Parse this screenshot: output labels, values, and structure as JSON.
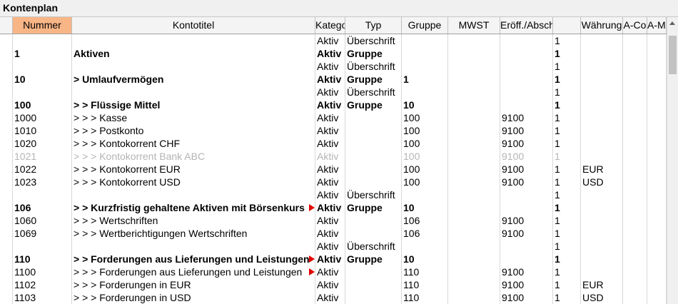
{
  "window": {
    "title": "Kontenplan"
  },
  "columns": [
    {
      "key": "nummer",
      "label": "Nummer"
    },
    {
      "key": "titel",
      "label": "Kontotitel"
    },
    {
      "key": "kategorie",
      "label": "Katego"
    },
    {
      "key": "typ",
      "label": "Typ"
    },
    {
      "key": "gruppe",
      "label": "Gruppe"
    },
    {
      "key": "mwst",
      "label": "MWST"
    },
    {
      "key": "eroeff",
      "label": "Eröff./Abschl."
    },
    {
      "key": "one",
      "label": ""
    },
    {
      "key": "waehrung",
      "label": "Währung"
    },
    {
      "key": "acode",
      "label": "A-Co"
    },
    {
      "key": "amode",
      "label": "A-Mo"
    }
  ],
  "active_column": "nummer",
  "rows": [
    {
      "style": "normal",
      "nummer": "",
      "titel": "",
      "kategorie": "Aktiv",
      "typ": "Überschrift",
      "gruppe": "",
      "mwst": "",
      "eroeff": "",
      "one": "1",
      "waehrung": "",
      "marker": false
    },
    {
      "style": "bold",
      "nummer": "1",
      "titel": "Aktiven",
      "kategorie": "Aktiv",
      "typ": "Gruppe",
      "gruppe": "",
      "mwst": "",
      "eroeff": "",
      "one": "1",
      "waehrung": "",
      "marker": false
    },
    {
      "style": "normal",
      "nummer": "",
      "titel": "",
      "kategorie": "Aktiv",
      "typ": "Überschrift",
      "gruppe": "",
      "mwst": "",
      "eroeff": "",
      "one": "1",
      "waehrung": "",
      "marker": false
    },
    {
      "style": "bold",
      "nummer": "10",
      "titel": " > Umlaufvermögen",
      "kategorie": "Aktiv",
      "typ": "Gruppe",
      "gruppe": "1",
      "mwst": "",
      "eroeff": "",
      "one": "1",
      "waehrung": "",
      "marker": false
    },
    {
      "style": "normal",
      "nummer": "",
      "titel": "",
      "kategorie": "Aktiv",
      "typ": "Überschrift",
      "gruppe": "",
      "mwst": "",
      "eroeff": "",
      "one": "1",
      "waehrung": "",
      "marker": false
    },
    {
      "style": "bold",
      "nummer": "100",
      "titel": " >  > Flüssige Mittel",
      "kategorie": "Aktiv",
      "typ": "Gruppe",
      "gruppe": "10",
      "mwst": "",
      "eroeff": "",
      "one": "1",
      "waehrung": "",
      "marker": false
    },
    {
      "style": "normal",
      "nummer": "1000",
      "titel": " >  >  > Kasse",
      "kategorie": "Aktiv",
      "typ": "",
      "gruppe": "100",
      "mwst": "",
      "eroeff": "9100",
      "one": "1",
      "waehrung": "",
      "marker": false
    },
    {
      "style": "normal",
      "nummer": "1010",
      "titel": " >  >  > Postkonto",
      "kategorie": "Aktiv",
      "typ": "",
      "gruppe": "100",
      "mwst": "",
      "eroeff": "9100",
      "one": "1",
      "waehrung": "",
      "marker": false
    },
    {
      "style": "normal",
      "nummer": "1020",
      "titel": " >  >  > Kontokorrent CHF",
      "kategorie": "Aktiv",
      "typ": "",
      "gruppe": "100",
      "mwst": "",
      "eroeff": "9100",
      "one": "1",
      "waehrung": "",
      "marker": false
    },
    {
      "style": "dim",
      "nummer": "1021",
      "titel": " >  >  > Kontokorrent Bank ABC",
      "kategorie": "Aktiv",
      "typ": "",
      "gruppe": "100",
      "mwst": "",
      "eroeff": "9100",
      "one": "1",
      "waehrung": "",
      "marker": false
    },
    {
      "style": "normal",
      "nummer": "1022",
      "titel": " >  >  > Kontokorrent EUR",
      "kategorie": "Aktiv",
      "typ": "",
      "gruppe": "100",
      "mwst": "",
      "eroeff": "9100",
      "one": "1",
      "waehrung": "EUR",
      "marker": false
    },
    {
      "style": "normal",
      "nummer": "1023",
      "titel": " >  >  > Kontokorrent USD",
      "kategorie": "Aktiv",
      "typ": "",
      "gruppe": "100",
      "mwst": "",
      "eroeff": "9100",
      "one": "1",
      "waehrung": "USD",
      "marker": false
    },
    {
      "style": "normal",
      "nummer": "",
      "titel": "",
      "kategorie": "Aktiv",
      "typ": "Überschrift",
      "gruppe": "",
      "mwst": "",
      "eroeff": "",
      "one": "1",
      "waehrung": "",
      "marker": false
    },
    {
      "style": "bold",
      "nummer": "106",
      "titel": " >  > Kurzfristig gehaltene Aktiven mit Börsenkurs",
      "kategorie": "Aktiv",
      "typ": "Gruppe",
      "gruppe": "10",
      "mwst": "",
      "eroeff": "",
      "one": "1",
      "waehrung": "",
      "marker": true
    },
    {
      "style": "normal",
      "nummer": "1060",
      "titel": " >  >  > Wertschriften",
      "kategorie": "Aktiv",
      "typ": "",
      "gruppe": "106",
      "mwst": "",
      "eroeff": "9100",
      "one": "1",
      "waehrung": "",
      "marker": false
    },
    {
      "style": "normal",
      "nummer": "1069",
      "titel": " >  >  > Wertberichtigungen Wertschriften",
      "kategorie": "Aktiv",
      "typ": "",
      "gruppe": "106",
      "mwst": "",
      "eroeff": "9100",
      "one": "1",
      "waehrung": "",
      "marker": false
    },
    {
      "style": "normal",
      "nummer": "",
      "titel": "",
      "kategorie": "Aktiv",
      "typ": "Überschrift",
      "gruppe": "",
      "mwst": "",
      "eroeff": "",
      "one": "1",
      "waehrung": "",
      "marker": false
    },
    {
      "style": "bold",
      "nummer": "110",
      "titel": " >  > Forderungen aus Lieferungen und Leistungen",
      "kategorie": "Aktiv",
      "typ": "Gruppe",
      "gruppe": "10",
      "mwst": "",
      "eroeff": "",
      "one": "1",
      "waehrung": "",
      "marker": true
    },
    {
      "style": "normal",
      "nummer": "1100",
      "titel": " >  >  > Forderungen aus Lieferungen und Leistungen",
      "kategorie": "Aktiv",
      "typ": "",
      "gruppe": "110",
      "mwst": "",
      "eroeff": "9100",
      "one": "1",
      "waehrung": "",
      "marker": true
    },
    {
      "style": "normal",
      "nummer": "1102",
      "titel": " >  >  > Forderungen in EUR",
      "kategorie": "Aktiv",
      "typ": "",
      "gruppe": "110",
      "mwst": "",
      "eroeff": "9100",
      "one": "1",
      "waehrung": "EUR",
      "marker": false
    },
    {
      "style": "normal",
      "nummer": "1103",
      "titel": " >  >  > Forderungen in USD",
      "kategorie": "Aktiv",
      "typ": "",
      "gruppe": "110",
      "mwst": "",
      "eroeff": "9100",
      "one": "1",
      "waehrung": "USD",
      "marker": false
    }
  ]
}
